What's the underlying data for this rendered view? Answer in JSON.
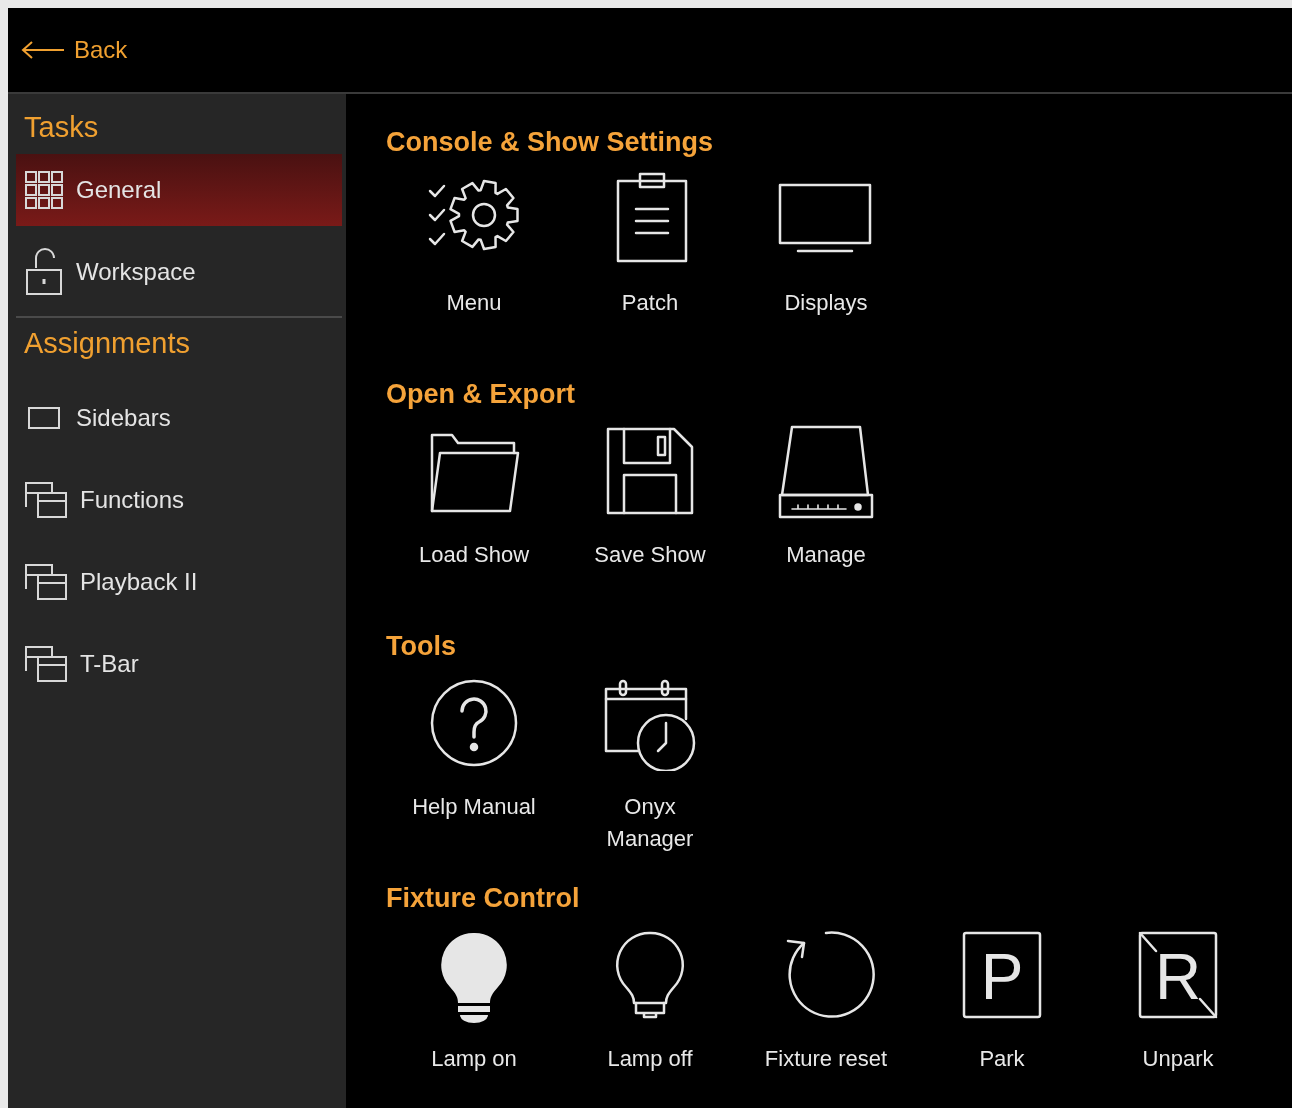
{
  "top_bar": {
    "back": "Back"
  },
  "sidebar": {
    "groups": [
      {
        "title": "Tasks",
        "items": [
          {
            "label": "General",
            "kind": "grid",
            "selected": true
          },
          {
            "label": "Workspace",
            "kind": "lock",
            "selected": false
          }
        ]
      },
      {
        "title": "Assignments",
        "items": [
          {
            "label": "Sidebars",
            "kind": "rect",
            "selected": false
          },
          {
            "label": "Functions",
            "kind": "windows",
            "selected": false
          },
          {
            "label": "Playback II",
            "kind": "windows",
            "selected": false
          },
          {
            "label": "T-Bar",
            "kind": "windows",
            "selected": false
          }
        ]
      }
    ]
  },
  "sections": [
    {
      "title": "Console & Show Settings",
      "tiles": [
        {
          "label": "Menu",
          "kind": "menu"
        },
        {
          "label": "Patch",
          "kind": "patch"
        },
        {
          "label": "Displays",
          "kind": "display"
        }
      ]
    },
    {
      "title": "Open & Export",
      "tiles": [
        {
          "label": "Load Show",
          "kind": "folder"
        },
        {
          "label": "Save Show",
          "kind": "save"
        },
        {
          "label": "Manage",
          "kind": "drive"
        }
      ]
    },
    {
      "title": "Tools",
      "tiles": [
        {
          "label": "Help Manual",
          "kind": "help"
        },
        {
          "label": "Onyx\nManager",
          "kind": "calendar"
        }
      ]
    },
    {
      "title": "Fixture Control",
      "tiles": [
        {
          "label": "Lamp on",
          "kind": "lamp"
        },
        {
          "label": "Lamp off",
          "kind": "bulb"
        },
        {
          "label": "Fixture reset",
          "kind": "reset"
        },
        {
          "label": "Park",
          "kind": "park",
          "glyph": "P"
        },
        {
          "label": "Unpark",
          "kind": "unpark",
          "glyph": "R"
        }
      ]
    }
  ]
}
